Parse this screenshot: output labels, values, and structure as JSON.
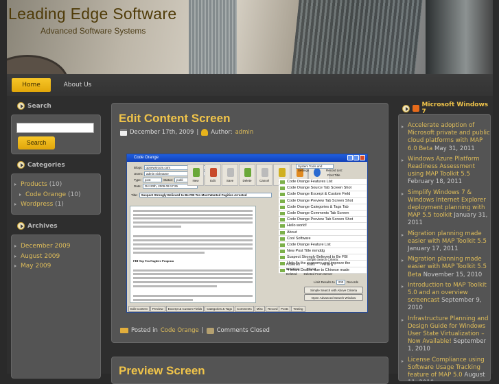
{
  "site": {
    "title": "Leading Edge Software",
    "tagline": "Advanced Software Systems"
  },
  "nav": [
    {
      "label": "Home",
      "active": true
    },
    {
      "label": "About Us"
    }
  ],
  "sidebar": {
    "search": {
      "title": "Search",
      "placeholder": "",
      "button": "Search"
    },
    "categories": {
      "title": "Categories",
      "items": [
        {
          "label": "Products",
          "count": "(10)"
        },
        {
          "label": "Code Orange",
          "count": "(10)"
        },
        {
          "label": "Wordpress",
          "count": "(1)"
        }
      ]
    },
    "archives": {
      "title": "Archives",
      "items": [
        "December 2009",
        "August 2009",
        "May 2009"
      ]
    }
  },
  "post": {
    "title": "Edit Content Screen",
    "date": "December 17th, 2009",
    "sep": "|",
    "author_label": "Author:",
    "author": "admin",
    "posted_in": "Posted in",
    "category": "Code Orange",
    "comments": "Comments Closed",
    "screenshot": {
      "window_title": "Code Orange",
      "fields": {
        "blogs_label": "Blogs:",
        "blogs": "opnewsroom.com",
        "users_label": "Users:",
        "users": "admin nickname",
        "type_label": "Type:",
        "type": "post",
        "status_label": "Status:",
        "status": "publi",
        "date_label": "Date:",
        "date": "Oct 20th, 2009 09:17:25",
        "title_label": "Title:",
        "title": "Suspect Strongly Believed to Be FBI Ten Most Wanted Fugitive Arrested"
      },
      "toolbar": [
        "New",
        "Edit",
        "Save",
        "Delete",
        "Cancel",
        "Sync",
        "Clear",
        "Options"
      ],
      "tools_select": "System Tools and Settings",
      "record_list_label": "Record List:",
      "post_title_col": "Post Title",
      "records": [
        "Code Orange Features List",
        "Code Orange Source Tab Screen Shot",
        "Code Orange Excerpt & Custom Field",
        "Code Orange Preview Tab Screen Shot",
        "Code Orange Categories & Tags Tab",
        "Code Orange Comments Tab Screen",
        "Code Orange Preview Tab Screen Shot",
        "Hello world!",
        "About",
        "Cool Software",
        "Code Orange Feature List",
        "New Post Title mmddg",
        "Suspect Strongly Believed to Be FBI",
        "Help fix the economy and improve the",
        "4 Infant Deaths due to Chinese made"
      ],
      "editor_heading": "FBI Top Ten Fugitive Program",
      "criteria_label": "Simple Search Criteria:",
      "criteria": [
        "Published",
        "Drafts",
        "Pending",
        "Revisions",
        "Private",
        "Deleted",
        "Deleted From Server"
      ],
      "limit_label": "Limit Results to",
      "limit": "200",
      "records_label": "Records",
      "search_btn": "Simple Search with Above Criteria",
      "adv_btn": "Open Advanced Search Window",
      "tabs": [
        "Edit Content",
        "Preview",
        "Excerpt & Custom Fields",
        "Categories & Tags",
        "Comments",
        "Misc",
        "Record Notes",
        "Testing"
      ],
      "right_tabs": [
        "Posts",
        "Testing"
      ]
    }
  },
  "next_post": {
    "title": "Preview Screen"
  },
  "rss": {
    "title": "Microsoft Windows 7",
    "items": [
      {
        "title": "Accelerate adoption of Microsoft private and public cloud platforms with MAP 6.0 Beta",
        "date": "May 31, 2011"
      },
      {
        "title": "Windows Azure Platform Readiness Assessment using MAP Toolkit 5.5",
        "date": "February 18, 2011"
      },
      {
        "title": "Simplify Windows 7 & Windows Internet Explorer deployment planning with MAP 5.5 toolkit",
        "date": "January 31, 2011"
      },
      {
        "title": "Migration planning made easier with MAP Toolkit 5.5",
        "date": "January 17, 2011"
      },
      {
        "title": "Migration planning made easier with MAP Toolkit 5.5 Beta",
        "date": "November 15, 2010"
      },
      {
        "title": "Introduction to MAP Toolkit 5.0 and an overview screencast",
        "date": "September 9, 2010"
      },
      {
        "title": "Infrastructure Planning and Design Guide for Windows User State Virtualization – Now Available!",
        "date": "September 1, 2010"
      },
      {
        "title": "License Compliance using Software Usage Tracking feature of MAP 5.0",
        "date": "August 11, 2010"
      },
      {
        "title": "SQL Server Discovery",
        "date": ""
      }
    ]
  }
}
